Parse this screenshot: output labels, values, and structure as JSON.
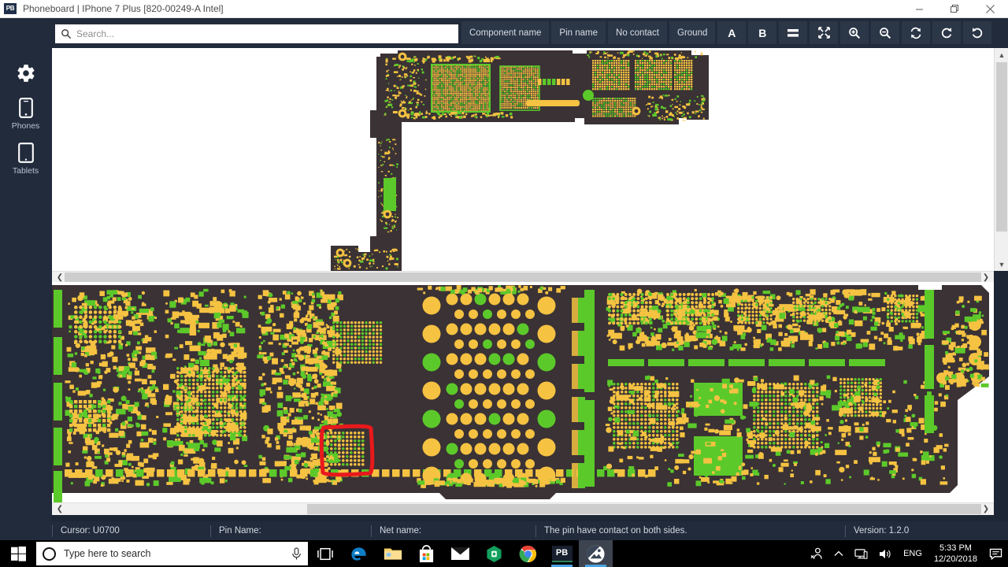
{
  "window": {
    "logo_text": "PB",
    "title": "Phoneboard | IPhone 7 Plus [820-00249-A Intel]",
    "minimize_label": "─",
    "restore_label": "❐",
    "close_label": "✕"
  },
  "search": {
    "placeholder": "Search...",
    "value": "",
    "icon": "search-icon"
  },
  "toolbar": {
    "buttons": [
      {
        "label": "Component name",
        "name": "component-name-button"
      },
      {
        "label": "Pin name",
        "name": "pin-name-button"
      },
      {
        "label": "No contact",
        "name": "no-contact-button"
      },
      {
        "label": "Ground",
        "name": "ground-button"
      }
    ],
    "icon_buttons": [
      {
        "label": "A",
        "name": "side-a-button",
        "icon": "letter-a-icon"
      },
      {
        "label": "B",
        "name": "side-b-button",
        "icon": "letter-b-icon"
      },
      {
        "label": "",
        "name": "split-view-button",
        "icon": "equals-icon"
      },
      {
        "label": "",
        "name": "fullscreen-button",
        "icon": "expand-arrows-icon"
      },
      {
        "label": "",
        "name": "zoom-in-button",
        "icon": "zoom-in-icon"
      },
      {
        "label": "",
        "name": "zoom-out-button",
        "icon": "zoom-out-icon"
      },
      {
        "label": "",
        "name": "sync-button",
        "icon": "sync-icon"
      },
      {
        "label": "",
        "name": "rotate-cw-button",
        "icon": "rotate-cw-icon"
      },
      {
        "label": "",
        "name": "reset-button",
        "icon": "rotate-ccw-icon"
      }
    ]
  },
  "sidebar": {
    "items": [
      {
        "label": "",
        "icon": "gear-icon",
        "name": "sidebar-item-settings"
      },
      {
        "label": "Phones",
        "icon": "phone-icon",
        "name": "sidebar-item-phones"
      },
      {
        "label": "Tablets",
        "icon": "tablet-icon",
        "name": "sidebar-item-tablets"
      }
    ]
  },
  "board": {
    "top_view_label": "board-top-view",
    "bottom_view_label": "board-bottom-view",
    "selection": {
      "component": "U0700",
      "color": "#e8191c"
    },
    "colors": {
      "substrate": "#3a3234",
      "pad_yellow": "#f5c242",
      "pad_green": "#5cc92a",
      "canvas": "#ffffff"
    }
  },
  "status": {
    "cursor_label": "Cursor: U0700",
    "pin_name_label": "Pin Name:",
    "net_name_label": "Net name:",
    "message": "The pin have contact on both sides.",
    "version": "Version: 1.2.0"
  },
  "taskbar": {
    "search_placeholder": "Type here to search",
    "mic_icon": "microphone-icon",
    "taskview_icon": "task-view-icon",
    "apps": [
      {
        "name": "edge-icon",
        "label": "e"
      },
      {
        "name": "file-explorer-icon",
        "label": ""
      },
      {
        "name": "microsoft-store-icon",
        "label": ""
      },
      {
        "name": "mail-icon",
        "label": ""
      },
      {
        "name": "green-hex-app-icon",
        "label": ""
      },
      {
        "name": "chrome-icon",
        "label": ""
      },
      {
        "name": "phoneboard-taskbar-icon",
        "label": "PB"
      },
      {
        "name": "photo-viewer-icon",
        "label": ""
      }
    ],
    "tray": {
      "people_icon": "people-icon",
      "chevron_icon": "chevron-up-icon",
      "network_icon": "network-icon",
      "volume_icon": "volume-icon",
      "language": "ENG",
      "time": "5:33 PM",
      "date": "12/20/2018",
      "action_center_icon": "notification-icon"
    }
  }
}
